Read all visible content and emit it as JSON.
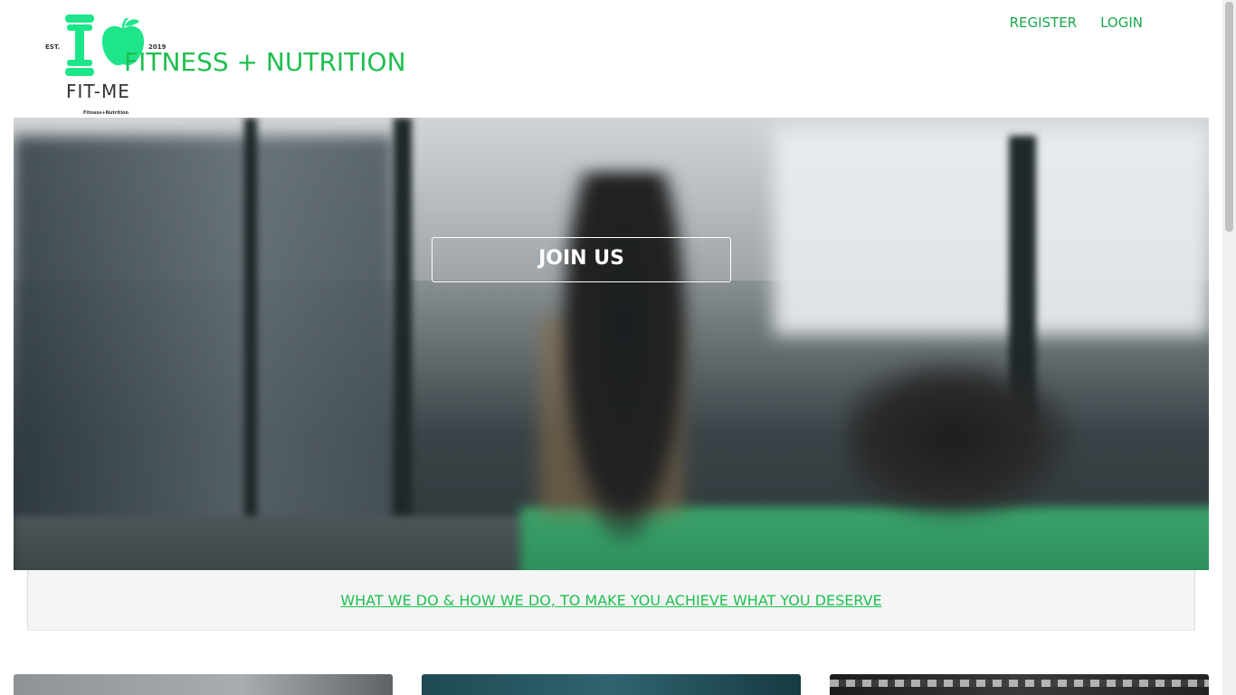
{
  "logo": {
    "est": "EST.",
    "year": "2019",
    "brand": "FIT-ME",
    "sub": "Fitness+Nutrition",
    "icons": [
      "dumbbell-icon",
      "apple-icon"
    ],
    "color": "#1fe58a"
  },
  "header": {
    "tagline": "FITNESS + NUTRITION"
  },
  "nav": {
    "register": "REGISTER",
    "login": "LOGIN"
  },
  "hero": {
    "cta": "JOIN US"
  },
  "banner": {
    "link": "WHAT WE DO & HOW WE DO, TO MAKE YOU ACHIEVE WHAT YOU DESERVE"
  },
  "colors": {
    "accent": "#1fbf50",
    "nav": "#1aa64a",
    "banner_bg": "#f5f5f5"
  }
}
